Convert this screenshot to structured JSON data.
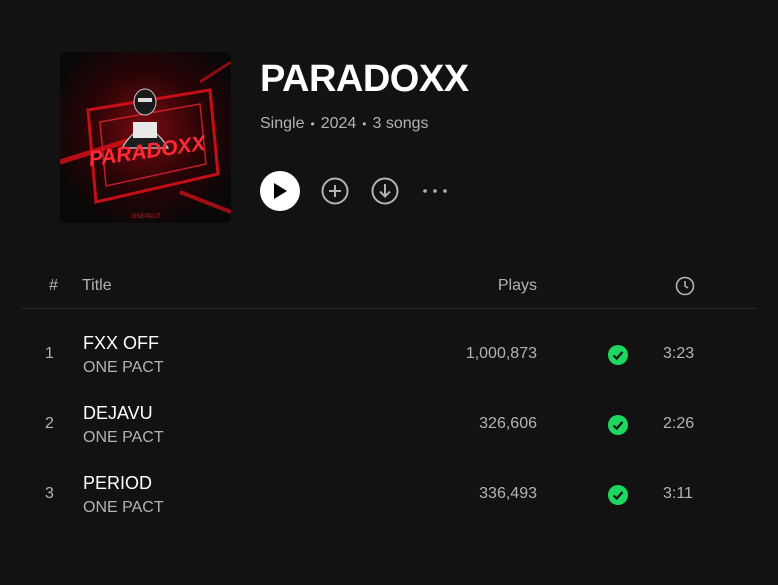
{
  "album": {
    "title": "PARADOXX",
    "type": "Single",
    "year": "2024",
    "song_count": "3 songs",
    "separator": "•",
    "cover_text": "PARADOXX",
    "cover_artist_mark": "ONEPACT"
  },
  "actions": {
    "play_icon": "play-icon",
    "add_icon": "plus-circle-icon",
    "download_icon": "download-circle-icon",
    "more_label": "···"
  },
  "table": {
    "headers": {
      "number": "#",
      "title": "Title",
      "plays": "Plays",
      "duration_icon": "clock-icon"
    },
    "tracks": [
      {
        "number": "1",
        "title": "FXX OFF",
        "artist": "ONE PACT",
        "plays": "1,000,873",
        "duration": "3:23",
        "saved": true
      },
      {
        "number": "2",
        "title": "DEJAVU",
        "artist": "ONE PACT",
        "plays": "326,606",
        "duration": "2:26",
        "saved": true
      },
      {
        "number": "3",
        "title": "PERIOD",
        "artist": "ONE PACT",
        "plays": "336,493",
        "duration": "3:11",
        "saved": true
      }
    ]
  },
  "colors": {
    "background": "#121212",
    "text_primary": "#ffffff",
    "text_secondary": "#b3b3b3",
    "accent_green": "#1ed760",
    "cover_red": "#e0101a"
  }
}
